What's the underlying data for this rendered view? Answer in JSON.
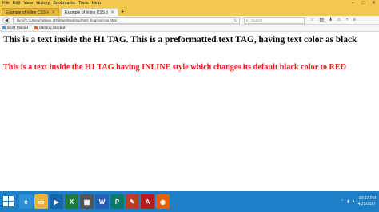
{
  "menu": {
    "items": [
      "File",
      "Edit",
      "View",
      "History",
      "Bookmarks",
      "Tools",
      "Help"
    ]
  },
  "window_controls": {
    "minimize": "–",
    "maximize": "□",
    "close": "✕"
  },
  "tabs": [
    {
      "label": "Example of Inline CSS in HTML -",
      "active": false
    },
    {
      "label": "Example of Inline CSS in HTML -",
      "active": true
    }
  ],
  "new_tab_label": "+",
  "navbar": {
    "url": "file:///C:/Users/rabbee.chhibber/Desktop/html blog/css/css.html",
    "search_placeholder": "Search"
  },
  "bookmarks": [
    {
      "label": "Most Visited",
      "icon": "star-icon",
      "color": "#4a90d9"
    },
    {
      "label": "Getting Started",
      "icon": "firefox-icon",
      "color": "#e66000"
    }
  ],
  "page": {
    "h1_plain": "This is a text inside the H1 TAG. This is a preformatted text TAG, having text color as black",
    "h1_inline": "This is a text inside the H1 TAG having INLINE style which changes its default black color to RED",
    "inline_color": "#ff1a1a"
  },
  "taskbar": {
    "apps": [
      {
        "name": "ie-icon",
        "glyph": "e",
        "color": "#2b8fd6"
      },
      {
        "name": "file-explorer-icon",
        "glyph": "▭",
        "color": "#e8b53a"
      },
      {
        "name": "media-player-icon",
        "glyph": "▶",
        "color": "#1565a8"
      },
      {
        "name": "excel-icon",
        "glyph": "X",
        "color": "#1f7a3e"
      },
      {
        "name": "calculator-icon",
        "glyph": "▦",
        "color": "#555555"
      },
      {
        "name": "word-icon",
        "glyph": "W",
        "color": "#2b5fb4"
      },
      {
        "name": "publisher-icon",
        "glyph": "P",
        "color": "#0b7a6b"
      },
      {
        "name": "paint-icon",
        "glyph": "✎",
        "color": "#c0392b"
      },
      {
        "name": "acrobat-icon",
        "glyph": "A",
        "color": "#b71c1c"
      },
      {
        "name": "firefox-icon",
        "glyph": "◉",
        "color": "#e66000"
      }
    ],
    "time": "10:37 PM",
    "date": "4/25/2017"
  }
}
